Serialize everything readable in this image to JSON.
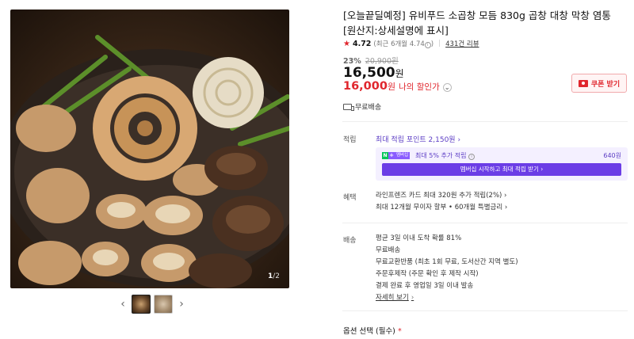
{
  "gallery": {
    "counter_current": "1",
    "counter_total": "/2",
    "prev_symbol": "‹",
    "next_symbol": "›"
  },
  "product": {
    "title": "[오늘끝딜예정] 유비푸드 소곱창 모듬 830g 곱창 대창 막창 염통 [원산지:상세설명에 표시]",
    "rating": "4.72",
    "rating_sub": "(최근 6개월 4.74",
    "rating_sub_close": ")",
    "reviews": "431건 리뷰",
    "discount_rate": "23%",
    "original_price": "20,900원",
    "sale_price": "16,500",
    "sale_price_unit": "원",
    "my_price": "16,000",
    "my_price_unit": "원",
    "my_price_label": "나의 할인가",
    "coupon_button": "쿠폰 받기",
    "shipping_top": "무료배송"
  },
  "benefits": {
    "points_label": "적립",
    "points_link": "최대 적립 포인트 2,150원 ›",
    "membership_badge": "멤버십",
    "points_extra": "최대 5% 추가 적립",
    "points_amount": "640원",
    "membership_button": "멤버십 시작하고 최대 적립 받기 ›",
    "perks_label": "혜택",
    "perks_line1": "라인프렌즈 카드 최대 320원 추가 적립(2%) ›",
    "perks_line2": "최대 12개월 무이자 할부 • 60개월 특별금리 ›"
  },
  "delivery": {
    "label": "배송",
    "line1": "평균 3일 이내 도착 확률 81%",
    "line2": "무료배송",
    "line3": "무료교환반품 (최초 1회 무료, 도서산간 지역 별도)",
    "line4": "주문후제작 (주문 확인 후 제작 시작)",
    "line5": "결제 완료 후 영업일 3일 이내 발송",
    "more": "자세히 보기"
  },
  "options": {
    "title": "옵션 선택 (필수)",
    "required_mark": "*"
  },
  "colors": {
    "accent_red": "#e0262d",
    "membership_purple": "#6b3de6"
  }
}
